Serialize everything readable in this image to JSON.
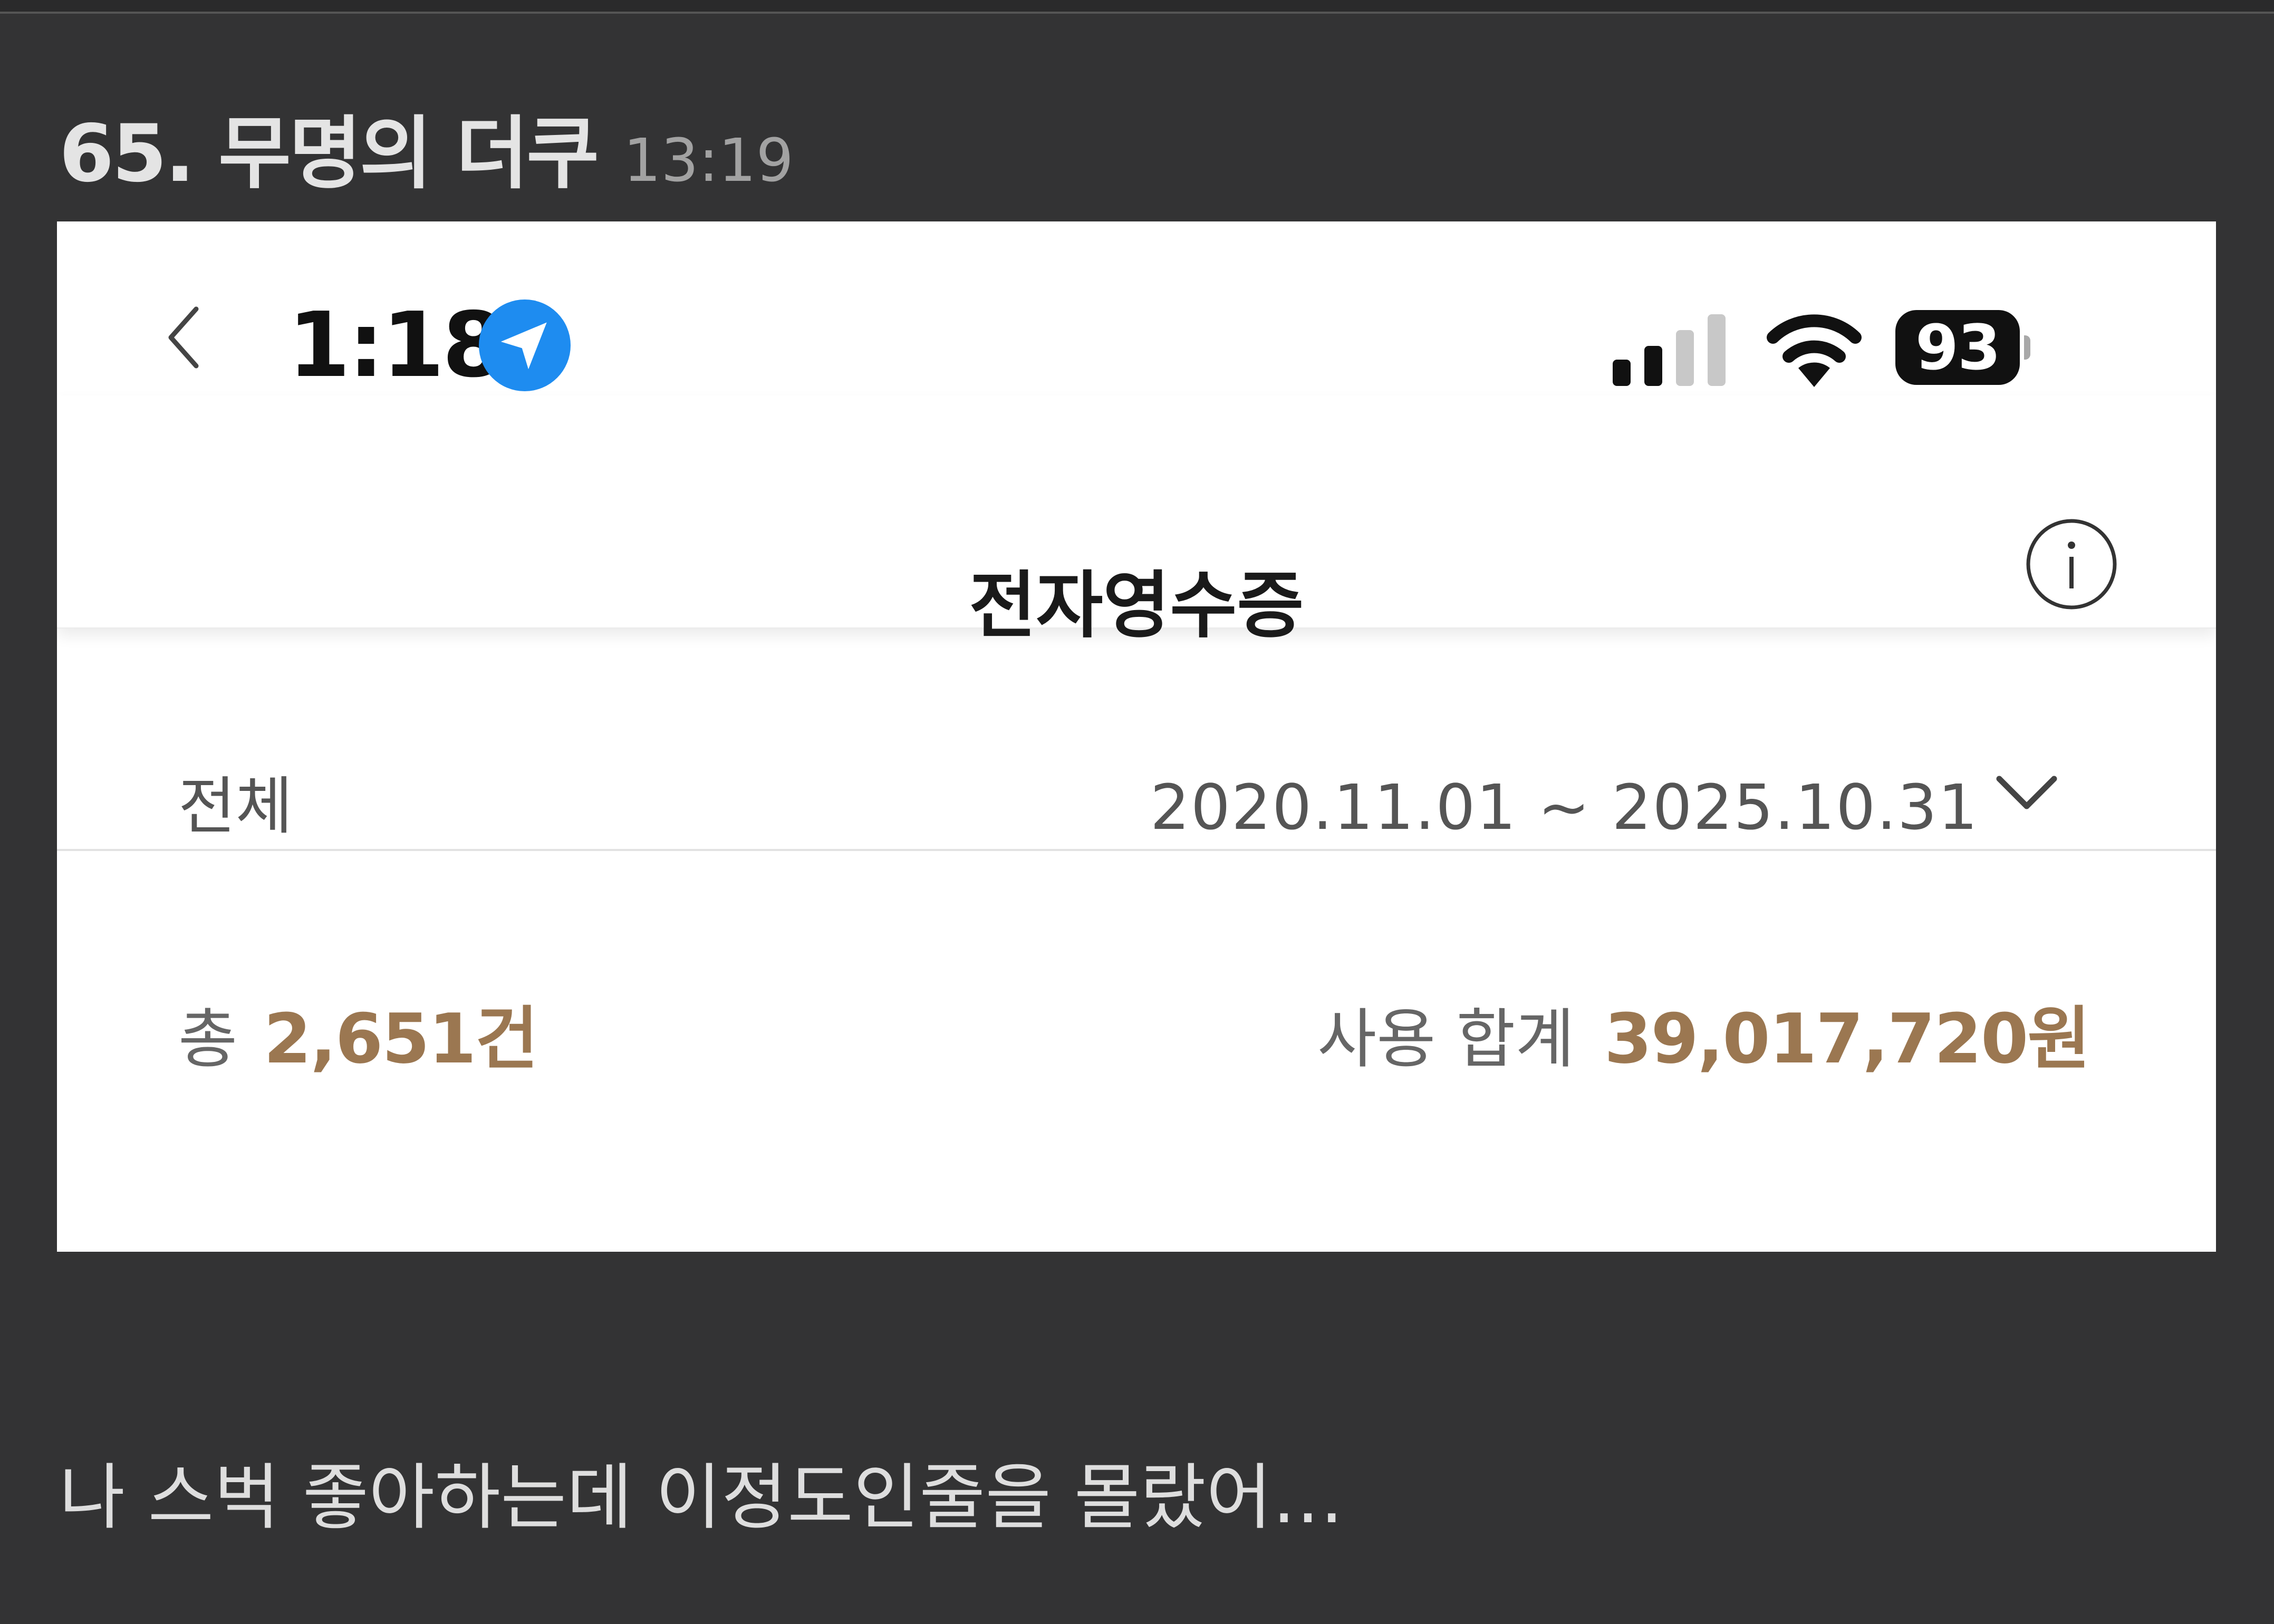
{
  "post": {
    "title": "65. 무명의 더쿠",
    "time": "13:19",
    "comment": "나 스벅 좋아하는데 이정도인줄을 몰랐어…"
  },
  "status_bar": {
    "clock": "1:18",
    "battery": "93",
    "icons": [
      "location-arrow-icon",
      "cellular-signal-icon",
      "wifi-icon",
      "battery-icon"
    ]
  },
  "nav": {
    "title": "전자영수증",
    "icons": [
      "back-chevron-icon",
      "info-icon"
    ]
  },
  "filter": {
    "label": "전체",
    "date_range": "2020.11.01 ~ 2025.10.31",
    "icon": "chevron-down-icon"
  },
  "summary": {
    "total_label": "총",
    "total_count": "2,651건",
    "sum_label": "사용 합계",
    "sum_value": "39,017,720원"
  },
  "colors": {
    "page_background": "#333334",
    "accent_brown": "#9b7751",
    "location_blue": "#1e8cf0"
  }
}
